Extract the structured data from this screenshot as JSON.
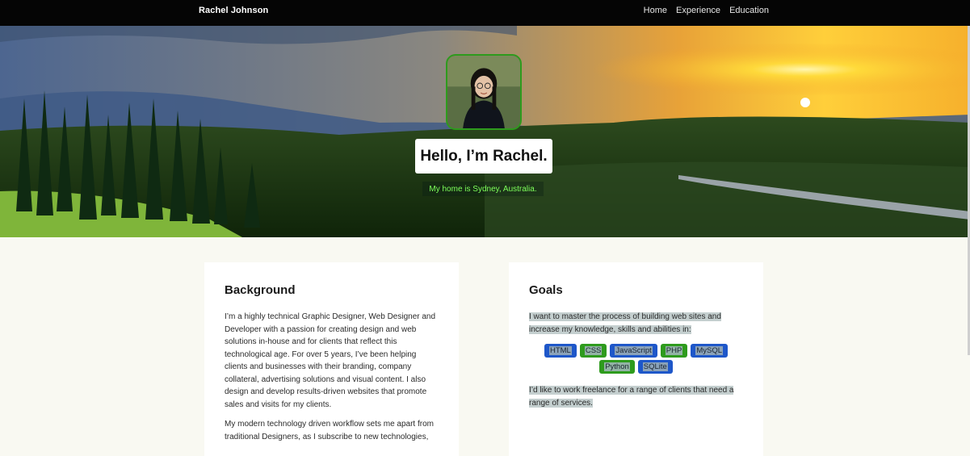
{
  "nav": {
    "brand": "Rachel Johnson",
    "links": [
      "Home",
      "Experience",
      "Education"
    ]
  },
  "hero": {
    "title": "Hello, I’m Rachel.",
    "subtitle": "My home is Sydney, Australia."
  },
  "background": {
    "heading": "Background",
    "paragraphs": [
      "I’m a highly technical Graphic Designer, Web Designer and Developer with a passion for creating design and web solutions in-house and for clients that reflect this technological age. For over 5 years, I’ve been helping clients and businesses with their branding, company collateral, advertising solutions and visual content. I also design and develop results-driven websites that promote sales and visits for my clients.",
      "My modern technology driven workflow sets me apart from traditional Designers, as I subscribe to new technologies,"
    ]
  },
  "goals": {
    "heading": "Goals",
    "intro": "I want to master the process of building web sites and increase my knowledge, skills and abilities in:",
    "skills": [
      {
        "label": "HTML",
        "color": "blue"
      },
      {
        "label": "CSS",
        "color": "green"
      },
      {
        "label": "JavaScript",
        "color": "blue"
      },
      {
        "label": "PHP",
        "color": "green"
      },
      {
        "label": "MySQL",
        "color": "blue"
      },
      {
        "label": "Python",
        "color": "green"
      },
      {
        "label": "SQLite",
        "color": "blue"
      }
    ],
    "outro": "I’d like to work freelance for a range of clients that need a range of services."
  },
  "colors": {
    "nav_bg": "#050505",
    "page_bg": "#f9f9f2",
    "badge_blue": "#1e57c9",
    "badge_green": "#2e9b1d",
    "subtitle_green": "#7dff5a"
  }
}
